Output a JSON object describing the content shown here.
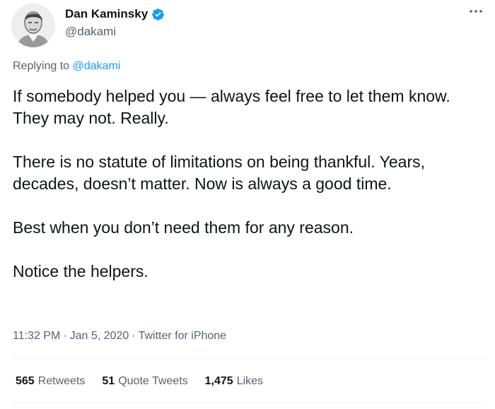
{
  "author": {
    "name": "Dan Kaminsky",
    "handle": "@dakami",
    "verified_color": "#1d9bf0"
  },
  "more_icon": "more-horizontal-icon",
  "reply_context": {
    "prefix": "Replying to",
    "mention": "@dakami"
  },
  "tweet": {
    "paragraphs": [
      "If somebody helped you — always feel free to let them know. They may not.  Really.",
      "There is no statute of limitations on being thankful. Years, decades, doesn’t matter. Now is always a good time.",
      "Best when you don’t need them for any reason.",
      "Notice the helpers."
    ]
  },
  "meta": {
    "time": "11:32 PM",
    "sep1": "·",
    "date": "Jan 5, 2020",
    "sep2": "·",
    "source": "Twitter for iPhone"
  },
  "stats": {
    "retweets": {
      "count": "565",
      "label": "Retweets"
    },
    "quotes": {
      "count": "51",
      "label": "Quote Tweets"
    },
    "likes": {
      "count": "1,475",
      "label": "Likes"
    }
  }
}
